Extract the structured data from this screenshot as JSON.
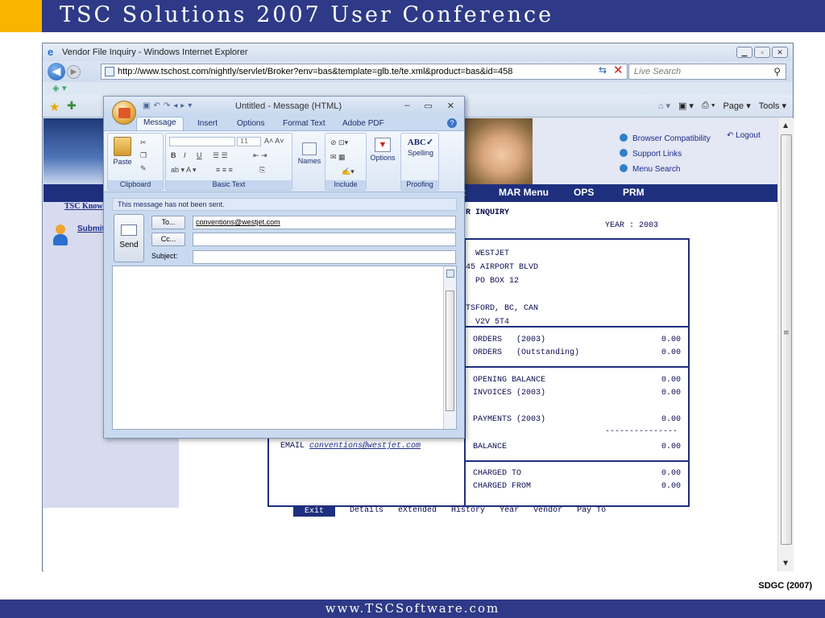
{
  "slide": {
    "title": "TSC Solutions 2007 User Conference",
    "footer": "www.TSCSoftware.com",
    "credit": "SDGC (2007)"
  },
  "browser": {
    "window_title": "Vendor File Inquiry - Windows Internet Explorer",
    "url": "http://www.tschost.com/nightly/servlet/Broker?env=bas&template=glb.te/te.xml&product=bas&id=458",
    "search_placeholder": "Live Search",
    "commands": [
      "Page ▾",
      "Tools ▾"
    ]
  },
  "page": {
    "header_links": [
      "Browser Compatibility",
      "Support Links",
      "Menu Search"
    ],
    "logout": "Logout",
    "nav_items": [
      "t",
      "MAR Menu",
      "OPS",
      "PRM"
    ],
    "left_nav": {
      "knowledge": "TSC Knowl",
      "submit": "Submit"
    },
    "inquiry_title": "R INQUIRY",
    "year_line": "YEAR : 2003",
    "address_lines": [
      "  WESTJET",
      "45 AIRPORT BLVD",
      "  PO BOX 12",
      "",
      "TSFORD, BC, CAN",
      "  V2V 5T4"
    ],
    "amounts": [
      {
        "label": "ORDERS   (2003)",
        "value": "0.00"
      },
      {
        "label": "ORDERS   (Outstanding)",
        "value": "0.00"
      },
      {
        "label": "OPENING BALANCE",
        "value": "0.00"
      },
      {
        "label": "INVOICES (2003)",
        "value": "0.00"
      },
      {
        "label": "PAYMENTS (2003)",
        "value": "0.00"
      },
      {
        "label": "BALANCE",
        "value": "0.00"
      },
      {
        "label": "CHARGED TO",
        "value": "0.00"
      },
      {
        "label": "CHARGED FROM",
        "value": "0.00"
      }
    ],
    "separator": "---------------",
    "email_label": "EMAIL",
    "email": "conventions@westjet.com",
    "function_keys": [
      "Exit",
      "Details",
      "eXtended",
      "History",
      "Year",
      "Vendor",
      "Pay To"
    ]
  },
  "message": {
    "title": "Untitled - Message (HTML)",
    "tabs": [
      "Message",
      "Insert",
      "Options",
      "Format Text",
      "Adobe PDF"
    ],
    "groups": {
      "clipboard": "Clipboard",
      "basic_text": "Basic Text",
      "include": "Include",
      "proofing": "Proofing"
    },
    "buttons": {
      "paste": "Paste",
      "names": "Names",
      "options": "Options",
      "spelling": "Spelling",
      "font_size": "11"
    },
    "notice": "This message has not been sent.",
    "send": "Send",
    "to_button": "To...",
    "cc_button": "Cc...",
    "subject_label": "Subject:",
    "to_value": "conventions@westjet.com",
    "cc_value": "",
    "subject_value": ""
  }
}
